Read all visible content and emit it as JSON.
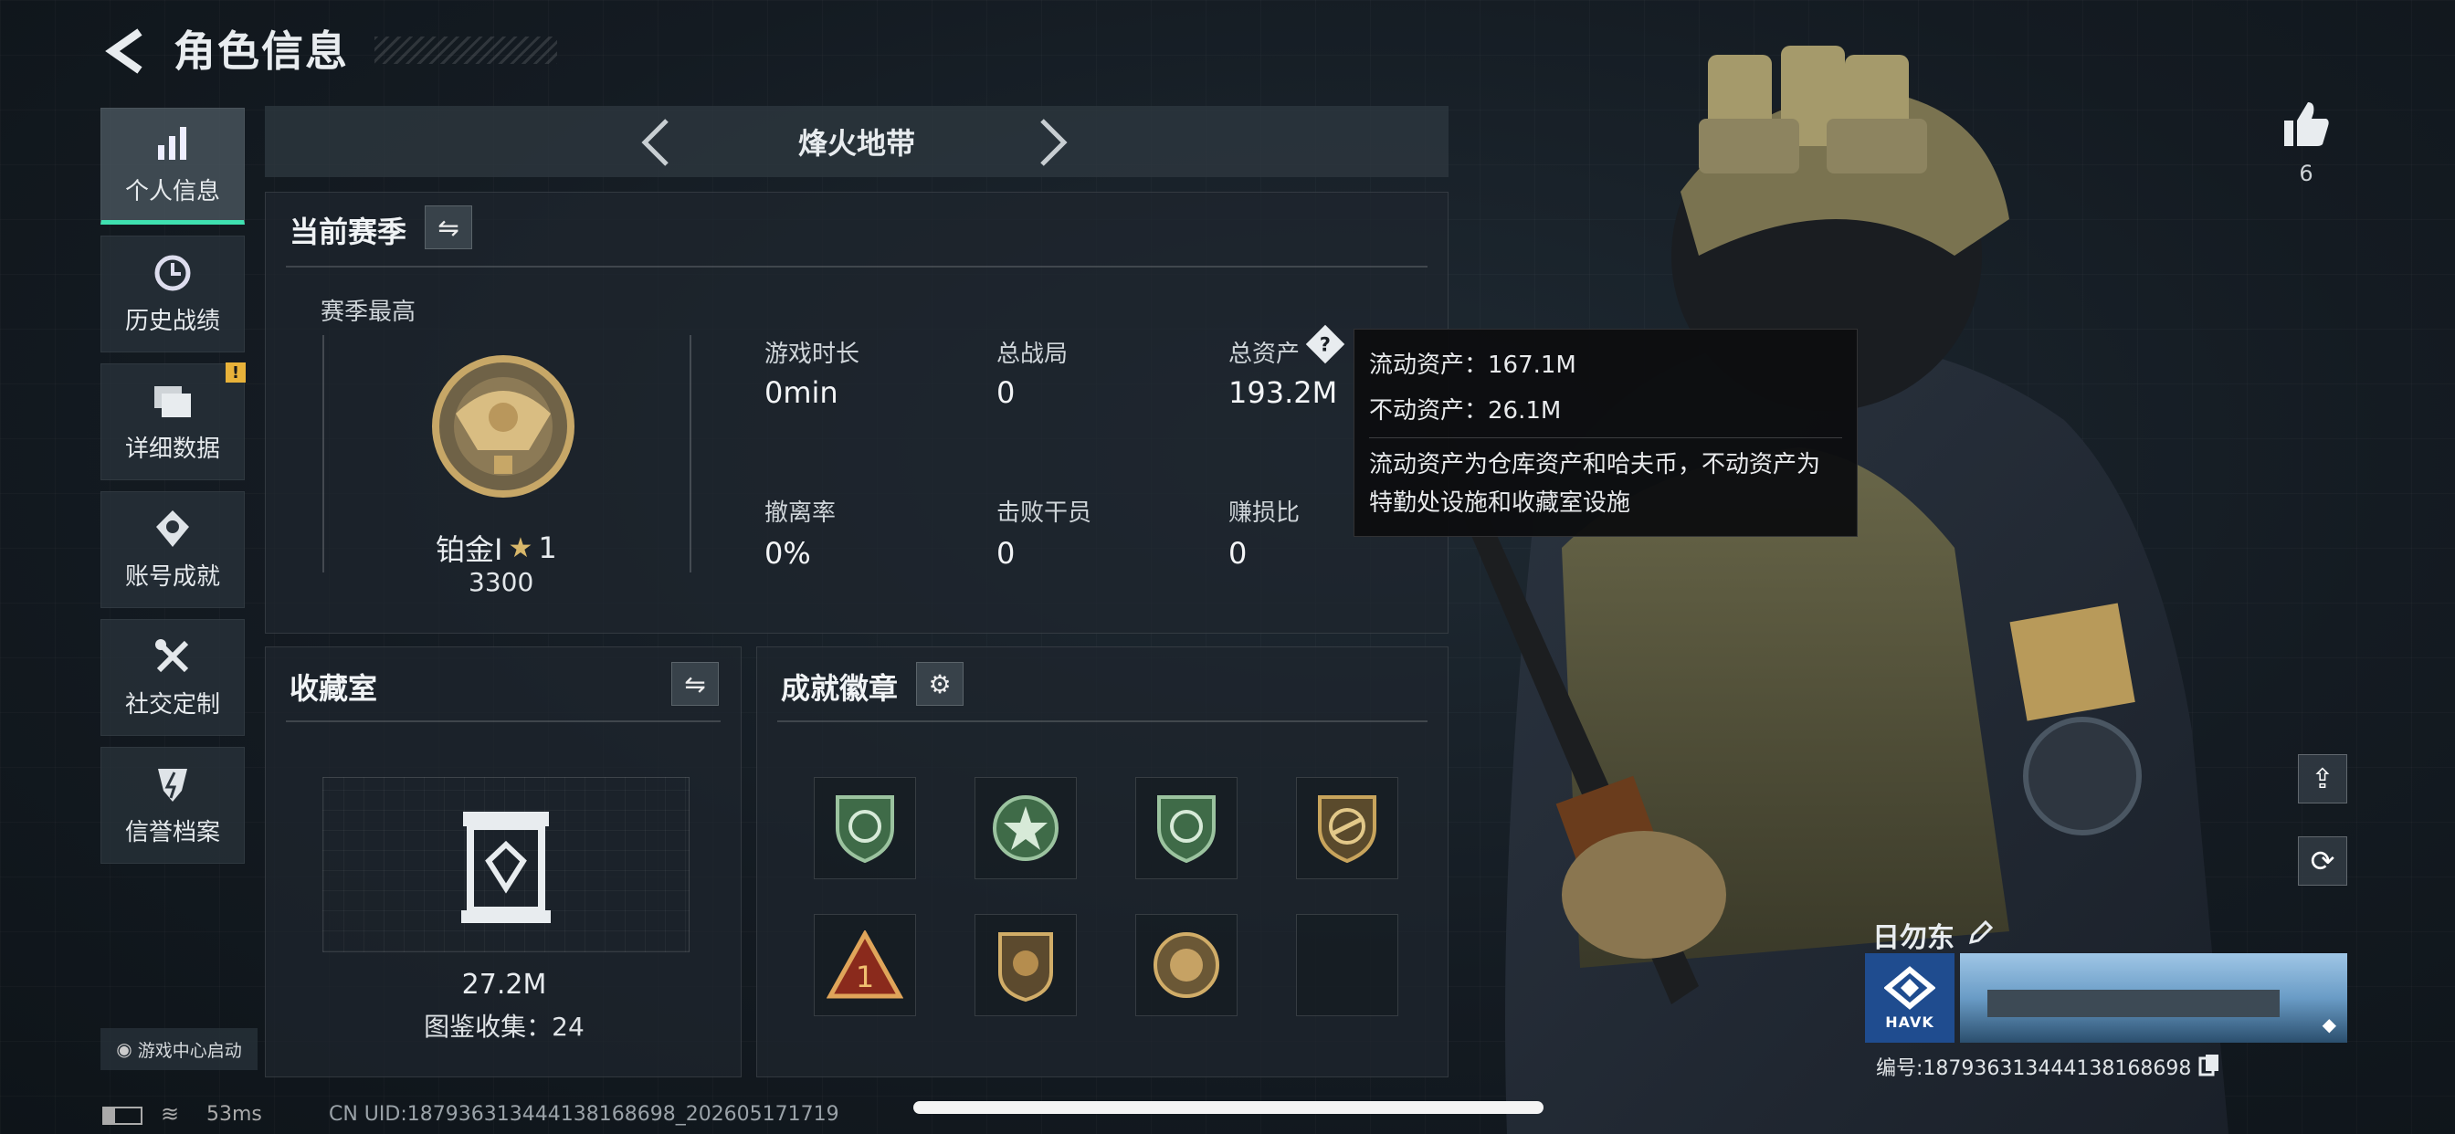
{
  "header": {
    "title": "角色信息"
  },
  "nav": {
    "items": [
      {
        "label": "个人信息",
        "icon": "bar-chart-icon",
        "active": true
      },
      {
        "label": "历史战绩",
        "icon": "clock-icon"
      },
      {
        "label": "详细数据",
        "icon": "folder-icon",
        "badge": "!"
      },
      {
        "label": "账号成就",
        "icon": "achievement-icon"
      },
      {
        "label": "社交定制",
        "icon": "tools-icon"
      },
      {
        "label": "信誉档案",
        "icon": "shield-icon"
      }
    ],
    "game_center_label": "游戏中心启动"
  },
  "mode": {
    "label": "烽火地带"
  },
  "season": {
    "title": "当前赛季",
    "best_label": "赛季最高",
    "rank_name": "铂金Ⅰ",
    "rank_stars": "1",
    "rank_score": "3300",
    "stats": [
      {
        "label": "游戏时长",
        "value": "0min"
      },
      {
        "label": "总战局",
        "value": "0"
      },
      {
        "label": "总资产",
        "value": "193.2M"
      },
      {
        "label": "撤离率",
        "value": "0%"
      },
      {
        "label": "击败干员",
        "value": "0"
      },
      {
        "label": "赚损比",
        "value": "0"
      }
    ]
  },
  "tooltip": {
    "line1": "流动资产：167.1M",
    "line2": "不动资产：26.1M",
    "desc": "流动资产为仓库资产和哈夫币，不动资产为特勤处设施和收藏室设施"
  },
  "collection": {
    "title": "收藏室",
    "value": "27.2M",
    "catalog": "图鉴收集：24"
  },
  "achievements": {
    "title": "成就徽章",
    "badges": [
      "green-shield-badge",
      "green-star-badge",
      "green-shield-badge",
      "gold-gun-badge",
      "red-triangle-badge",
      "gold-crest-badge",
      "gold-round-badge",
      "empty-slot"
    ]
  },
  "player": {
    "name": "日勿东",
    "likes": "6",
    "team_logo_text": "HAVK",
    "uid_label": "编号:18793631344413816​8698"
  },
  "footer": {
    "ping": "53ms",
    "uid": "CN UID:18793631344413816​8698_202605171719"
  },
  "colors": {
    "accent": "#3fe0b0",
    "warning": "#e8b23a",
    "tooltip_bg": "#0c0e10"
  }
}
